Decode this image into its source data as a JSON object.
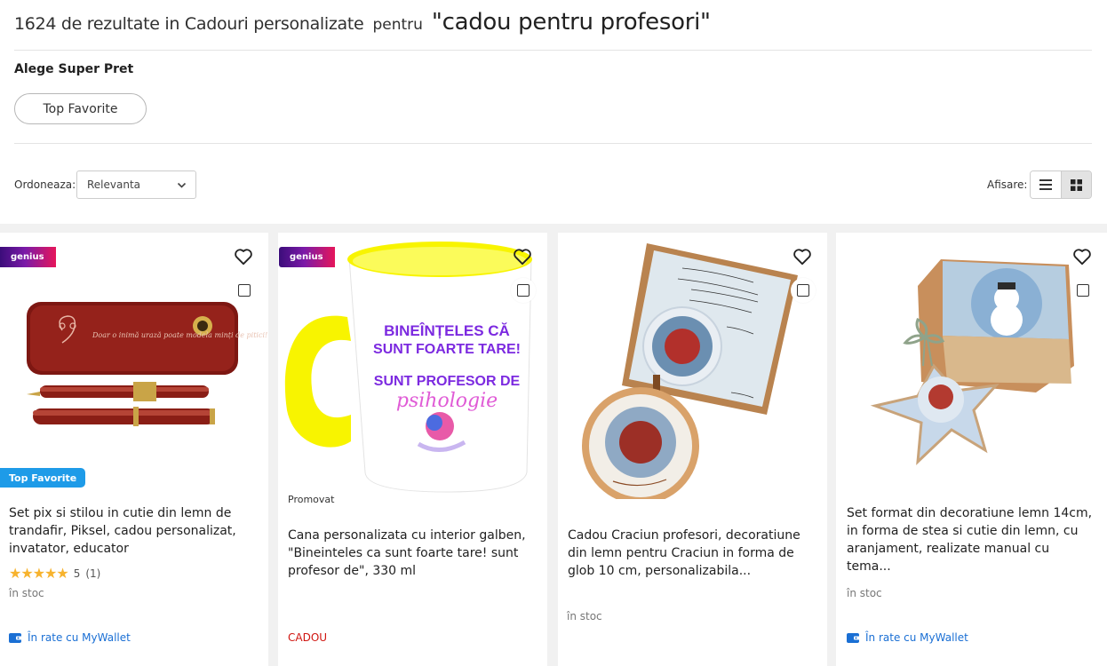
{
  "header": {
    "results_count": "1624 de rezultate in Cadouri personalizate",
    "results_for": "pentru",
    "query": "\"cadou pentru profesori\""
  },
  "filters": {
    "title": "Alege Super Pret",
    "chip_label": "Top Favorite"
  },
  "toolbar": {
    "sort_label": "Ordoneaza:",
    "sort_value": "Relevanta",
    "view_label": "Afisare:"
  },
  "products": [
    {
      "badge": "genius",
      "top_favorite": "Top Favorite",
      "title": "Set pix si stilou in cutie din lemn de trandafir, Piksel, cadou personalizat, invatator, educator",
      "rating_stars": 5,
      "rating_value": "5",
      "rating_count": "(1)",
      "stock": "în stoc",
      "wallet": "În rate cu MyWallet",
      "image_text": "Doar o inimă urază poate modela minți de pitici!"
    },
    {
      "badge": "genius",
      "promoted": "Promovat",
      "title": "Cana personalizata cu interior galben, \"Bineinteles ca sunt foarte tare! sunt profesor de\", 330 ml",
      "tag": "CADOU",
      "mug_line1": "BINEÎNȚELES CĂ",
      "mug_line2": "SUNT FOARTE TARE!",
      "mug_line3": "SUNT PROFESOR DE",
      "mug_line4": "psihologie"
    },
    {
      "title": "Cadou Craciun profesori, decoratiune din lemn pentru Craciun in forma de glob 10 cm, personalizabila...",
      "stock": "în stoc"
    },
    {
      "title": "Set format din decoratiune lemn 14cm, in forma de stea si cutie din lemn, cu aranjament, realizate manual cu tema...",
      "stock": "în stoc",
      "wallet": "În rate cu MyWallet"
    }
  ],
  "colors": {
    "genius_start": "#3b0d7a",
    "genius_end": "#e6165a",
    "top_favorite": "#1e9be8",
    "wallet_link": "#1a6fd4",
    "cadou_tag": "#d0140f",
    "star": "#f7b32e"
  }
}
